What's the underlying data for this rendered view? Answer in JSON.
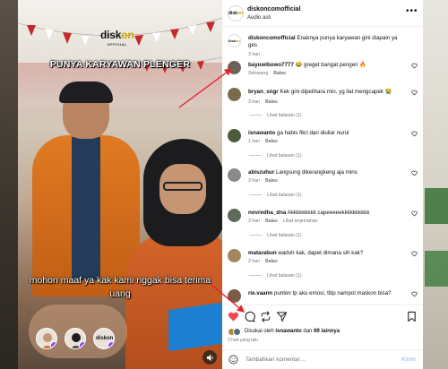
{
  "video": {
    "brand_prefix": "disk",
    "brand_accent": "on",
    "brand_tagline": "OFFICIAL",
    "headline": "PUNYA KARYAWAN PLENGER",
    "caption": "mohon maaf ya kak kami nggak bisa terima uang",
    "avatar_labels": [
      "",
      "",
      "diskon"
    ]
  },
  "post": {
    "username": "diskoncomofficial",
    "audio": "Audio asli",
    "more_label": "•••",
    "mini_logo_prefix": "disk",
    "mini_logo_accent": "on"
  },
  "caption_comment": {
    "username": "diskoncomofficial",
    "text": "Enaknya punya karyawan gini diapain ya ges",
    "time": "3 hari"
  },
  "comments": [
    {
      "username": "bayuwibowo7777",
      "text": "😂 greget bangat pengen 🔥",
      "time": "Sekarang",
      "reply": "Balas",
      "extra": "",
      "replies": ""
    },
    {
      "username": "bryan_sngr",
      "text": "Kek gini dipelihara min, yg liat mengcapek 😭",
      "time": "3 hari",
      "reply": "Balas",
      "extra": "",
      "replies": "Lihat balasan (1)"
    },
    {
      "username": "isnawanto",
      "text": "ga habis fikri dan diuliar nurul",
      "time": "1 hari",
      "reply": "Balas",
      "extra": "",
      "replies": "Lihat balasan (1)"
    },
    {
      "username": "abiszuhur",
      "text": "Langsung dikerangkeng aja mins",
      "time": "3 hari",
      "reply": "Balas",
      "extra": "",
      "replies": "Lihat balasan (1)"
    },
    {
      "username": "novredha_dna",
      "text": "Akkkkkkkkk capeeeeekkkkkkkkkk",
      "time": "3 hari",
      "reply": "Balas",
      "extra": "Lihat terjemahan",
      "replies": "Lihat balasan (1)"
    },
    {
      "username": "matarabun",
      "text": "waduh kak, dapet dimana sih kak?",
      "time": "2 hari",
      "reply": "Balas",
      "extra": "",
      "replies": "Lihat balasan (1)"
    },
    {
      "username": "rie.vaann",
      "text": "punten tp aku emosi, titip nampol maskon bisa?",
      "time": "",
      "reply": "",
      "extra": "",
      "replies": ""
    }
  ],
  "likes": {
    "prefix": "Disukai oleh",
    "user": "isnawanto",
    "middle": "dan",
    "count_text": "69 lainnya",
    "time": "3 hari yang lalu"
  },
  "comment_input": {
    "placeholder": "Tambahkan komentar…",
    "post_label": "Kirim"
  },
  "colors": {
    "like_red": "#ed4956",
    "annotation_red": "#e5242c",
    "brand_gold": "#c9a500",
    "post_disabled": "#a8c8f0"
  },
  "icons": {
    "post_more": "more-horizontal-icon",
    "comment_like": "heart-outline-icon",
    "like": "heart-filled-icon",
    "comment": "speech-bubble-icon",
    "repost": "repost-icon",
    "share": "paper-plane-icon",
    "save": "bookmark-icon",
    "emoji": "smiley-icon",
    "mute": "speaker-icon"
  }
}
